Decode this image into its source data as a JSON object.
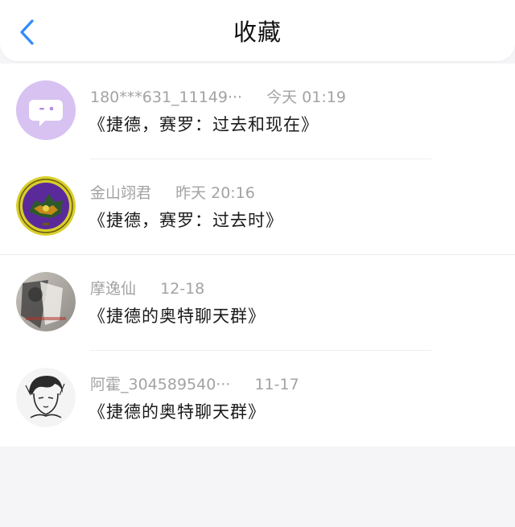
{
  "header": {
    "title": "收藏",
    "back_icon": "chevron-left-icon",
    "accent": "#2f8cff"
  },
  "items": [
    {
      "name": "180***631_11149···",
      "time": "今天 01:19",
      "message": "《捷德，赛罗：过去和现在》",
      "avatar": "chat-bubble-avatar"
    },
    {
      "name": "金山翊君",
      "time": "昨天 20:16",
      "message": "《捷德，赛罗：过去时》",
      "avatar": "emblem-avatar"
    },
    {
      "name": "摩逸仙",
      "time": "12-18",
      "message": "《捷德的奥特聊天群》",
      "avatar": "photo-avatar"
    },
    {
      "name": "阿霍_304589540···",
      "time": "11-17",
      "message": "《捷德的奥特聊天群》",
      "avatar": "sketch-avatar"
    }
  ]
}
